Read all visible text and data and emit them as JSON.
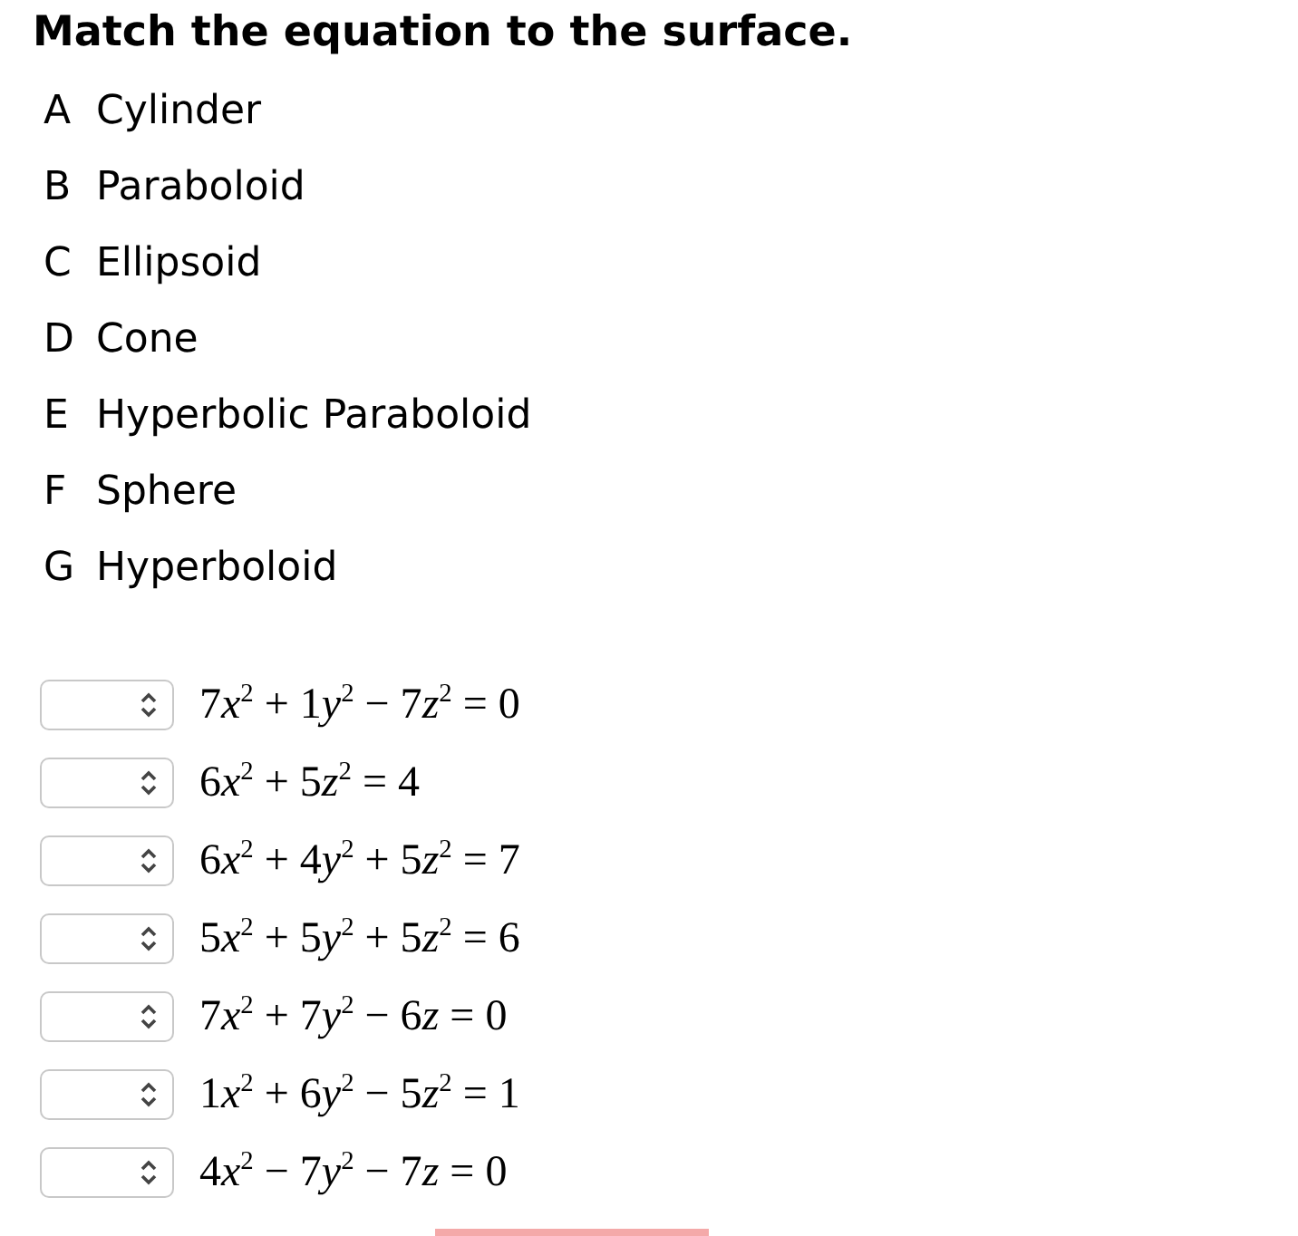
{
  "title": "Match the equation to the surface.",
  "options": [
    {
      "letter": "A",
      "name": "Cylinder"
    },
    {
      "letter": "B",
      "name": "Paraboloid"
    },
    {
      "letter": "C",
      "name": "Ellipsoid"
    },
    {
      "letter": "D",
      "name": "Cone"
    },
    {
      "letter": "E",
      "name": "Hyperbolic Paraboloid"
    },
    {
      "letter": "F",
      "name": "Sphere"
    },
    {
      "letter": "G",
      "name": "Hyperboloid"
    }
  ],
  "equations": [
    {
      "equation": "7x$^{2}$ + 1y$^{2}$ − 7z$^{2}$ = 0"
    },
    {
      "equation": "6x$^{2}$ + 5z$^{2}$ = 4"
    },
    {
      "equation": "6x$^{2}$ + 4y$^{2}$ + 5z$^{2}$ = 7"
    },
    {
      "equation": "5x$^{2}$ + 5y$^{2}$ + 5z$^{2}$ = 6"
    },
    {
      "equation": "7x$^{2}$ + 7y$^{2}$ − 6z = 0"
    },
    {
      "equation": "1x$^{2}$ + 6y$^{2}$ − 5z$^{2}$ = 1"
    },
    {
      "equation": "4x$^{2}$ − 7y$^{2}$ − 7z = 0"
    }
  ]
}
